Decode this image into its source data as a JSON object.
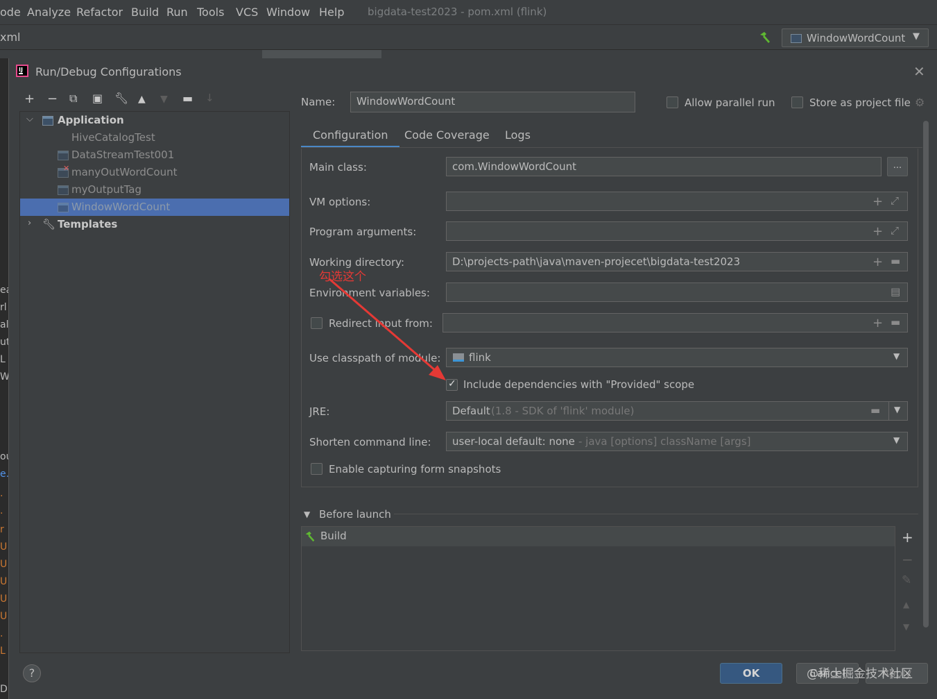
{
  "menubar": {
    "items": [
      "ode",
      "Analyze",
      "Refactor",
      "Build",
      "Run",
      "Tools",
      "VCS",
      "Window",
      "Help"
    ],
    "window_title": "bigdata-test2023 - pom.xml (flink)"
  },
  "navbar": {
    "crumb": "xml",
    "run_config": "WindowWordCount"
  },
  "gutter_chars": [
    "ea",
    "rl",
    "al",
    "ut",
    "L",
    "W",
    "ou",
    "e.",
    ".",
    ".",
    "r",
    "U",
    "U",
    "U",
    "U",
    "U",
    ".",
    "L",
    "D"
  ],
  "dialog": {
    "title": "Run/Debug Configurations",
    "tree": {
      "application": "Application",
      "items": [
        "HiveCatalogTest",
        "DataStreamTest001",
        "manyOutWordCount",
        "myOutputTag",
        "WindowWordCount"
      ],
      "templates": "Templates"
    },
    "name_label": "Name:",
    "name_value": "WindowWordCount",
    "allow_parallel": "Allow parallel run",
    "store_project": "Store as project file",
    "tabs": [
      "Configuration",
      "Code Coverage",
      "Logs"
    ],
    "main_class_label": "Main class:",
    "main_class_value": "com.WindowWordCount",
    "vm_options_label": "VM options:",
    "program_args_label": "Program arguments:",
    "working_dir_label": "Working directory:",
    "working_dir_value": "D:\\projects-path\\java\\maven-projecet\\bigdata-test2023",
    "env_vars_label": "Environment variables:",
    "redirect_label": "Redirect input from:",
    "classpath_label": "Use classpath of module:",
    "classpath_value": "flink",
    "include_deps": "Include dependencies with \"Provided\" scope",
    "jre_label": "JRE:",
    "jre_value": "Default",
    "jre_hint": "(1.8 - SDK of 'flink' module)",
    "shorten_label": "Shorten command line:",
    "shorten_value": "user-local default: none",
    "shorten_hint": "- java [options] className [args]",
    "snapshots_label": "Enable capturing form snapshots",
    "before_launch": "Before launch",
    "build_task": "Build",
    "ok": "OK",
    "cancel": "Cancel",
    "apply": "Apply",
    "help": "?"
  },
  "annotation": "勾选这个",
  "watermark": "@稀土掘金技术社区",
  "colors": {
    "background": "#3c3f41",
    "selection": "#4b6eaf",
    "annotation": "#e53935",
    "ok_button": "#365880"
  }
}
